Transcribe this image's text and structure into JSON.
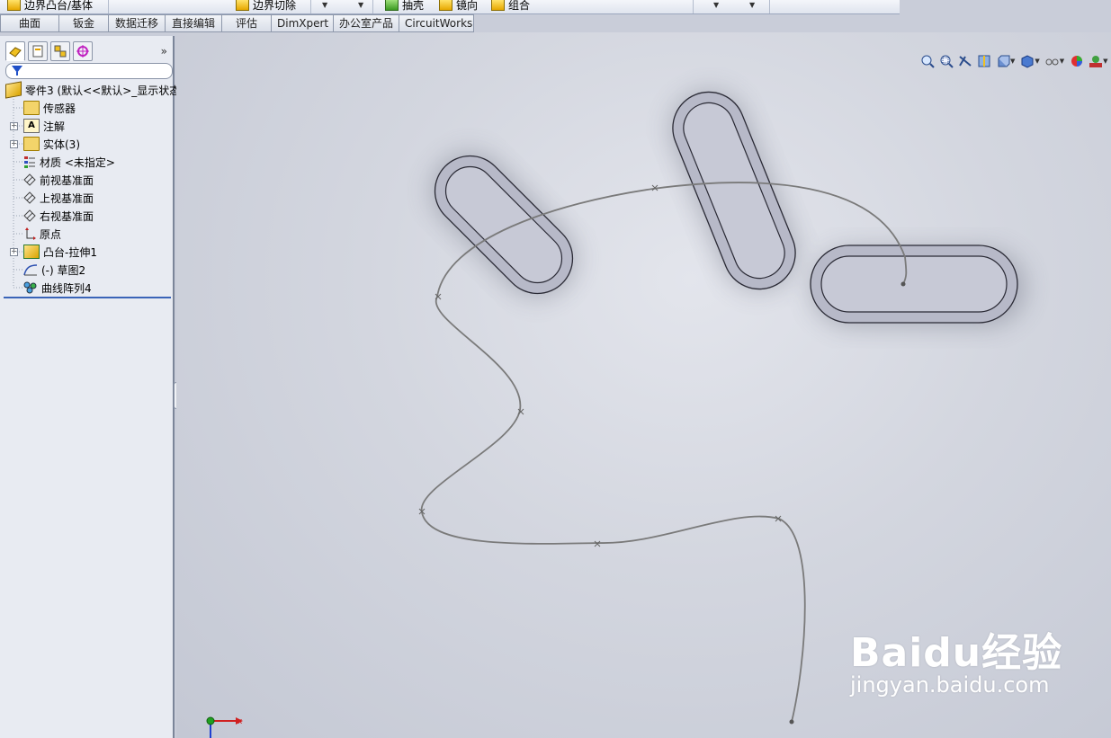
{
  "toolbar": {
    "items": [
      {
        "label": "边界凸台/基体",
        "icon": "boss-icon"
      },
      {
        "label": "边界切除",
        "icon": "cut-icon"
      },
      {
        "label": "抽壳",
        "icon": "shell-icon"
      },
      {
        "label": "镜向",
        "icon": "mirror-icon"
      },
      {
        "label": "组合",
        "icon": "combine-icon"
      }
    ]
  },
  "tabs": [
    "曲面",
    "钣金",
    "数据迁移",
    "直接编辑",
    "评估",
    "DimXpert",
    "办公室产品",
    "CircuitWorks"
  ],
  "panel": {
    "expand_glyph": "»",
    "tree": [
      {
        "label": "零件3  (默认<<默认>_显示状态",
        "icon": "part-icon"
      },
      {
        "label": "传感器",
        "icon": "sensor-folder-icon"
      },
      {
        "label": "注解",
        "icon": "annotation-icon",
        "expandable": true
      },
      {
        "label": "实体(3)",
        "icon": "solid-bodies-folder-icon",
        "expandable": true
      },
      {
        "label": "材质 <未指定>",
        "icon": "material-icon"
      },
      {
        "label": "前视基准面",
        "icon": "plane-icon"
      },
      {
        "label": "上视基准面",
        "icon": "plane-icon"
      },
      {
        "label": "右视基准面",
        "icon": "plane-icon"
      },
      {
        "label": "原点",
        "icon": "origin-icon"
      },
      {
        "label": "凸台-拉伸1",
        "icon": "extrude-icon",
        "expandable": true
      },
      {
        "label": "(-) 草图2",
        "icon": "sketch-icon"
      },
      {
        "label": "曲线阵列4",
        "icon": "curve-pattern-icon"
      }
    ]
  },
  "watermark": {
    "brand": "Baidu经验",
    "url": "jingyan.baidu.com"
  },
  "triad": {
    "x_label": "x"
  },
  "colors": {
    "accent": "#3a64b8",
    "graphics_bg": "#d3d6df",
    "slot_fill": "#b8bac8",
    "curve": "#7a7a7a"
  }
}
